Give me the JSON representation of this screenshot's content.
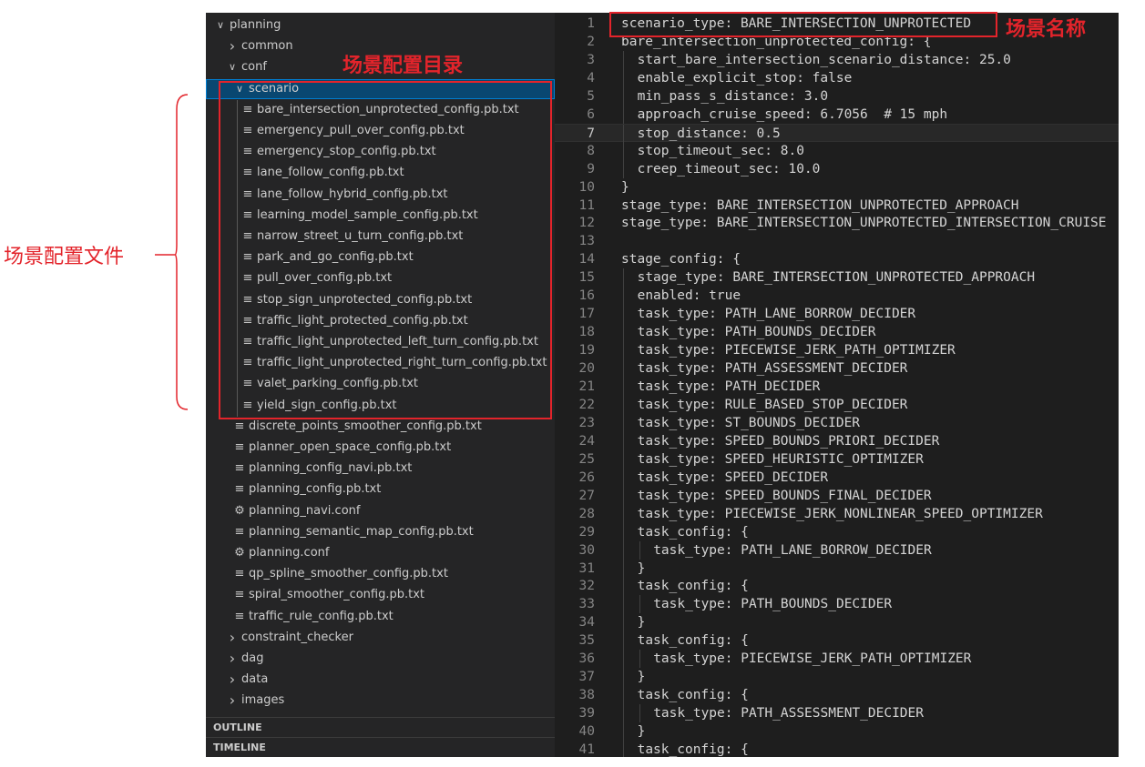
{
  "explorer": {
    "items": [
      {
        "label": "planning",
        "type": "folder",
        "expanded": true,
        "depth": 0
      },
      {
        "label": "common",
        "type": "folder",
        "expanded": false,
        "depth": 1
      },
      {
        "label": "conf",
        "type": "folder",
        "expanded": true,
        "depth": 1
      },
      {
        "label": "scenario",
        "type": "folder",
        "expanded": true,
        "depth": 2,
        "selected": true
      },
      {
        "label": "bare_intersection_unprotected_config.pb.txt",
        "type": "file",
        "depth": 3
      },
      {
        "label": "emergency_pull_over_config.pb.txt",
        "type": "file",
        "depth": 3
      },
      {
        "label": "emergency_stop_config.pb.txt",
        "type": "file",
        "depth": 3
      },
      {
        "label": "lane_follow_config.pb.txt",
        "type": "file",
        "depth": 3
      },
      {
        "label": "lane_follow_hybrid_config.pb.txt",
        "type": "file",
        "depth": 3
      },
      {
        "label": "learning_model_sample_config.pb.txt",
        "type": "file",
        "depth": 3
      },
      {
        "label": "narrow_street_u_turn_config.pb.txt",
        "type": "file",
        "depth": 3
      },
      {
        "label": "park_and_go_config.pb.txt",
        "type": "file",
        "depth": 3
      },
      {
        "label": "pull_over_config.pb.txt",
        "type": "file",
        "depth": 3
      },
      {
        "label": "stop_sign_unprotected_config.pb.txt",
        "type": "file",
        "depth": 3
      },
      {
        "label": "traffic_light_protected_config.pb.txt",
        "type": "file",
        "depth": 3
      },
      {
        "label": "traffic_light_unprotected_left_turn_config.pb.txt",
        "type": "file",
        "depth": 3
      },
      {
        "label": "traffic_light_unprotected_right_turn_config.pb.txt",
        "type": "file",
        "depth": 3
      },
      {
        "label": "valet_parking_config.pb.txt",
        "type": "file",
        "depth": 3
      },
      {
        "label": "yield_sign_config.pb.txt",
        "type": "file",
        "depth": 3
      },
      {
        "label": "discrete_points_smoother_config.pb.txt",
        "type": "file",
        "depth": 2
      },
      {
        "label": "planner_open_space_config.pb.txt",
        "type": "file",
        "depth": 2
      },
      {
        "label": "planning_config_navi.pb.txt",
        "type": "file",
        "depth": 2
      },
      {
        "label": "planning_config.pb.txt",
        "type": "file",
        "depth": 2
      },
      {
        "label": "planning_navi.conf",
        "type": "gear",
        "depth": 2
      },
      {
        "label": "planning_semantic_map_config.pb.txt",
        "type": "file",
        "depth": 2
      },
      {
        "label": "planning.conf",
        "type": "gear",
        "depth": 2
      },
      {
        "label": "qp_spline_smoother_config.pb.txt",
        "type": "file",
        "depth": 2
      },
      {
        "label": "spiral_smoother_config.pb.txt",
        "type": "file",
        "depth": 2
      },
      {
        "label": "traffic_rule_config.pb.txt",
        "type": "file",
        "depth": 2
      },
      {
        "label": "constraint_checker",
        "type": "folder",
        "expanded": false,
        "depth": 1
      },
      {
        "label": "dag",
        "type": "folder",
        "expanded": false,
        "depth": 1
      },
      {
        "label": "data",
        "type": "folder",
        "expanded": false,
        "depth": 1
      },
      {
        "label": "images",
        "type": "folder",
        "expanded": false,
        "depth": 1
      }
    ],
    "panels": {
      "outline": "OUTLINE",
      "timeline": "TIMELINE"
    }
  },
  "editor": {
    "active_line": 7,
    "lines": [
      {
        "n": "1",
        "text": "scenario_type: BARE_INTERSECTION_UNPROTECTED",
        "indent": 0
      },
      {
        "n": "2",
        "text": "bare_intersection_unprotected_config: {",
        "indent": 0
      },
      {
        "n": "3",
        "text": "start_bare_intersection_scenario_distance: 25.0",
        "indent": 1
      },
      {
        "n": "4",
        "text": "enable_explicit_stop: false",
        "indent": 1
      },
      {
        "n": "5",
        "text": "min_pass_s_distance: 3.0",
        "indent": 1
      },
      {
        "n": "6",
        "text": "approach_cruise_speed: 6.7056  # 15 mph",
        "indent": 1
      },
      {
        "n": "7",
        "text": "stop_distance: 0.5",
        "indent": 1
      },
      {
        "n": "8",
        "text": "stop_timeout_sec: 8.0",
        "indent": 1
      },
      {
        "n": "9",
        "text": "creep_timeout_sec: 10.0",
        "indent": 1
      },
      {
        "n": "10",
        "text": "}",
        "indent": 0
      },
      {
        "n": "11",
        "text": "stage_type: BARE_INTERSECTION_UNPROTECTED_APPROACH",
        "indent": 0
      },
      {
        "n": "12",
        "text": "stage_type: BARE_INTERSECTION_UNPROTECTED_INTERSECTION_CRUISE",
        "indent": 0
      },
      {
        "n": "13",
        "text": "",
        "indent": 0
      },
      {
        "n": "14",
        "text": "stage_config: {",
        "indent": 0
      },
      {
        "n": "15",
        "text": "stage_type: BARE_INTERSECTION_UNPROTECTED_APPROACH",
        "indent": 1
      },
      {
        "n": "16",
        "text": "enabled: true",
        "indent": 1
      },
      {
        "n": "17",
        "text": "task_type: PATH_LANE_BORROW_DECIDER",
        "indent": 1
      },
      {
        "n": "18",
        "text": "task_type: PATH_BOUNDS_DECIDER",
        "indent": 1
      },
      {
        "n": "19",
        "text": "task_type: PIECEWISE_JERK_PATH_OPTIMIZER",
        "indent": 1
      },
      {
        "n": "20",
        "text": "task_type: PATH_ASSESSMENT_DECIDER",
        "indent": 1
      },
      {
        "n": "21",
        "text": "task_type: PATH_DECIDER",
        "indent": 1
      },
      {
        "n": "22",
        "text": "task_type: RULE_BASED_STOP_DECIDER",
        "indent": 1
      },
      {
        "n": "23",
        "text": "task_type: ST_BOUNDS_DECIDER",
        "indent": 1
      },
      {
        "n": "24",
        "text": "task_type: SPEED_BOUNDS_PRIORI_DECIDER",
        "indent": 1
      },
      {
        "n": "25",
        "text": "task_type: SPEED_HEURISTIC_OPTIMIZER",
        "indent": 1
      },
      {
        "n": "26",
        "text": "task_type: SPEED_DECIDER",
        "indent": 1
      },
      {
        "n": "27",
        "text": "task_type: SPEED_BOUNDS_FINAL_DECIDER",
        "indent": 1
      },
      {
        "n": "28",
        "text": "task_type: PIECEWISE_JERK_NONLINEAR_SPEED_OPTIMIZER",
        "indent": 1
      },
      {
        "n": "29",
        "text": "task_config: {",
        "indent": 1
      },
      {
        "n": "30",
        "text": "task_type: PATH_LANE_BORROW_DECIDER",
        "indent": 2
      },
      {
        "n": "31",
        "text": "}",
        "indent": 1
      },
      {
        "n": "32",
        "text": "task_config: {",
        "indent": 1
      },
      {
        "n": "33",
        "text": "task_type: PATH_BOUNDS_DECIDER",
        "indent": 2
      },
      {
        "n": "34",
        "text": "}",
        "indent": 1
      },
      {
        "n": "35",
        "text": "task_config: {",
        "indent": 1
      },
      {
        "n": "36",
        "text": "task_type: PIECEWISE_JERK_PATH_OPTIMIZER",
        "indent": 2
      },
      {
        "n": "37",
        "text": "}",
        "indent": 1
      },
      {
        "n": "38",
        "text": "task_config: {",
        "indent": 1
      },
      {
        "n": "39",
        "text": "task_type: PATH_ASSESSMENT_DECIDER",
        "indent": 2
      },
      {
        "n": "40",
        "text": "}",
        "indent": 1
      },
      {
        "n": "41",
        "text": "task_config: {",
        "indent": 1
      }
    ]
  },
  "annotations": {
    "scene_config_dir": "场景配置目录",
    "scene_config_files": "场景配置文件",
    "scene_name": "场景名称",
    "color": "#e3242b"
  }
}
